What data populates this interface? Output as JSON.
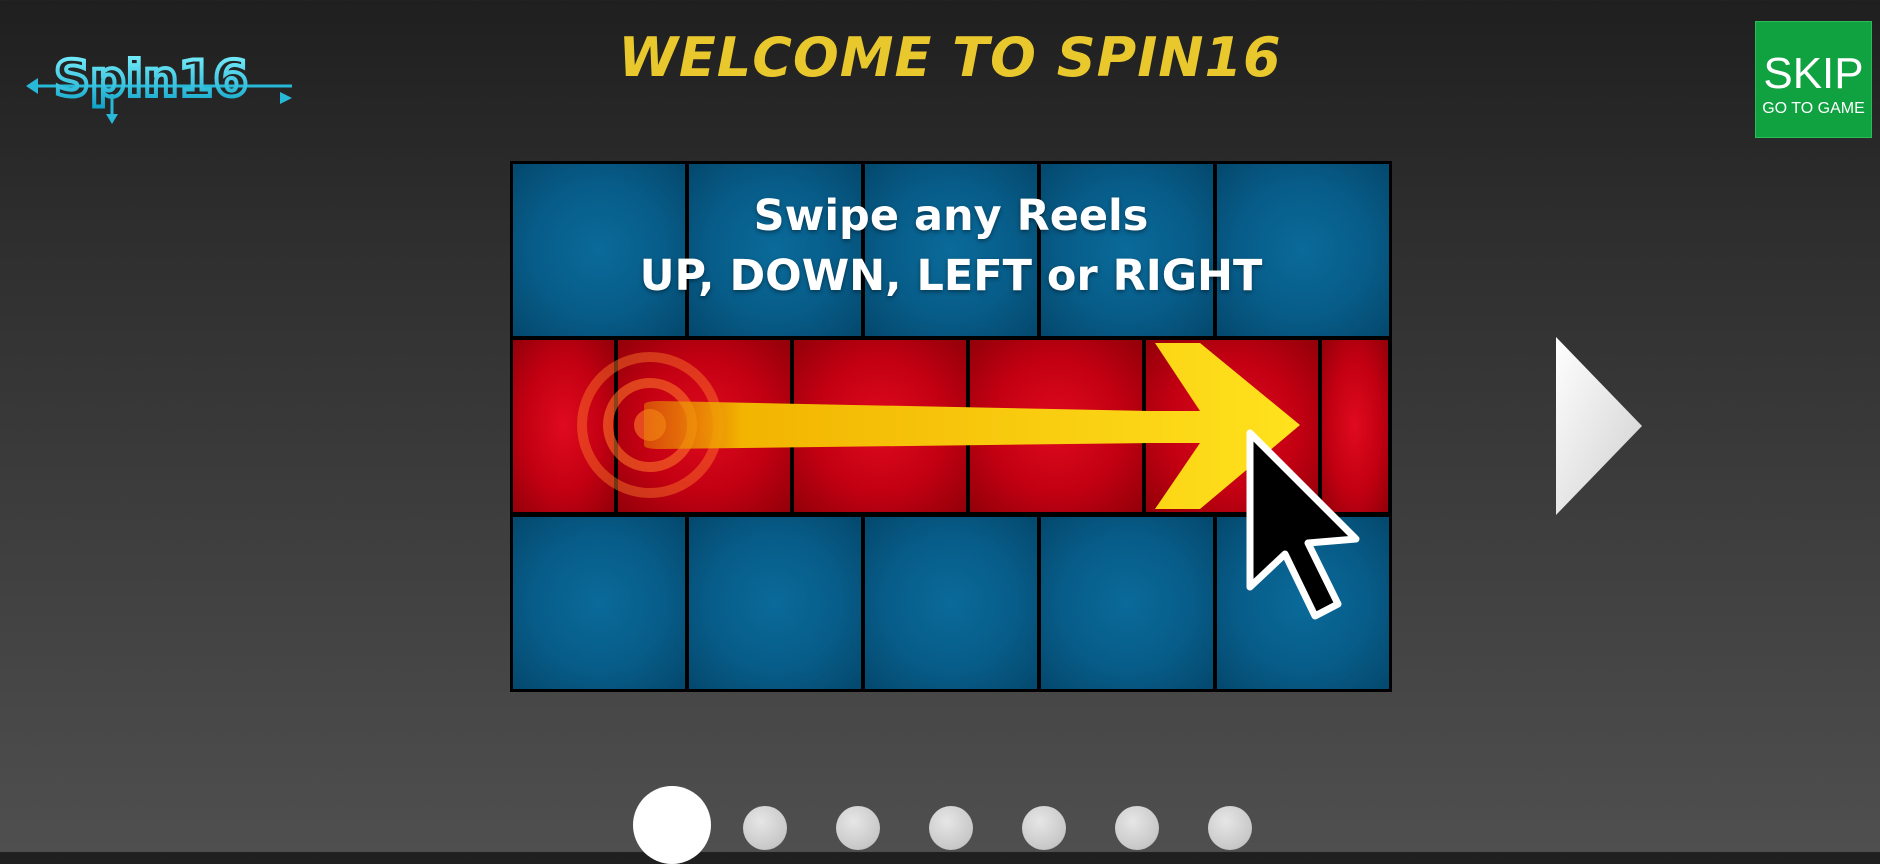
{
  "header": {
    "logo_text": "Spin16",
    "title": "WELCOME TO SPIN16"
  },
  "skip_button": {
    "label": "SKIP",
    "sublabel": "GO TO GAME"
  },
  "tutorial": {
    "line1": "Swipe any Reels",
    "line2": "UP, DOWN, LEFT or RIGHT",
    "highlighted_row": 2,
    "swipe_direction": "right",
    "pointer_icon": "mouse-cursor-icon"
  },
  "pagination": {
    "total": 7,
    "current": 1
  },
  "colors": {
    "title_yellow": "#e9c82d",
    "skip_green": "#10a141",
    "reel_blue": "#075c88",
    "reel_red": "#c20012",
    "arrow_yellow": "#f5c400"
  }
}
